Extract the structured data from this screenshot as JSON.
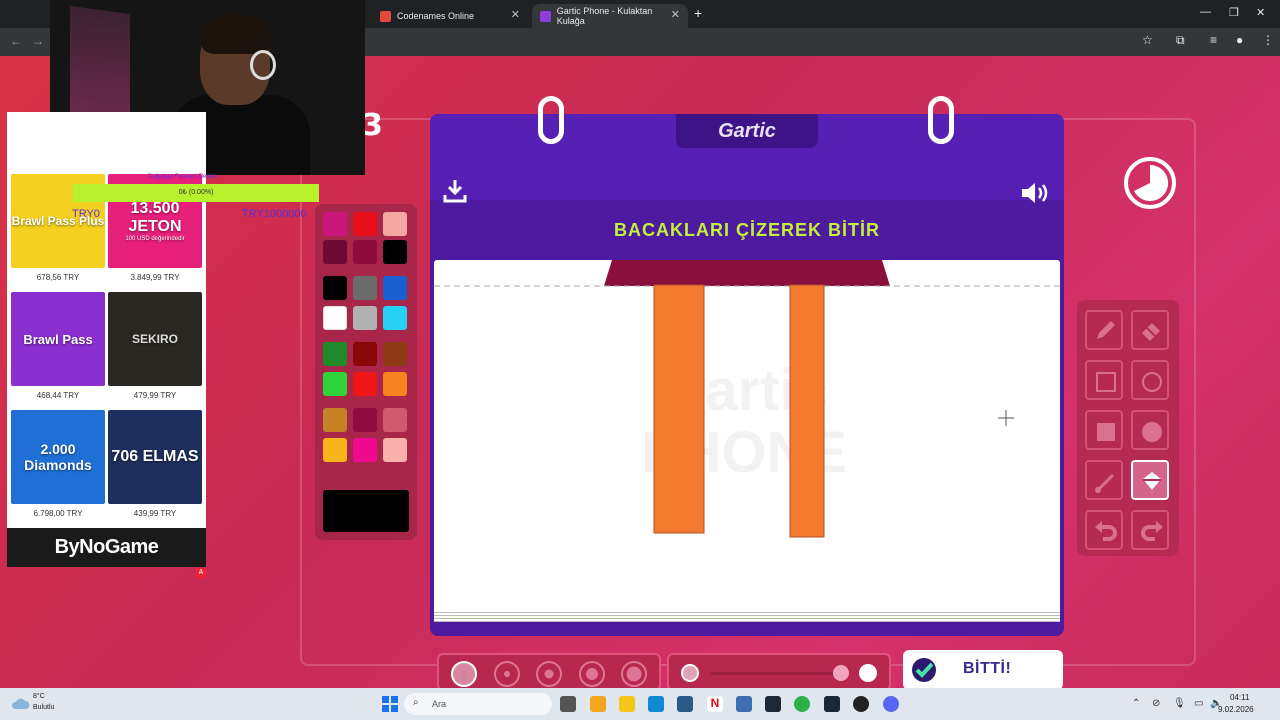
{
  "browser": {
    "tabs": [
      {
        "title": "Codenames Online"
      },
      {
        "title": "Gartic Phone - Kulaktan Kulağa"
      }
    ]
  },
  "game": {
    "round_number": "3",
    "logo": "Gartic",
    "prompt": "BACAKLARI ÇİZEREK BİTİR",
    "done_button": "BİTTİ!",
    "watermark_top": "Gartic",
    "watermark_bottom": "PHONE",
    "palette_colors": [
      "#c8157a",
      "#e80f1a",
      "#f7a7a2",
      "#6d0a33",
      "#8e0a3c",
      "#000000",
      "#000000",
      "#6b6b6b",
      "#1a5fd1",
      "#ffffff",
      "#b1b1b1",
      "#27d1f3",
      "#1e8a2a",
      "#8a0808",
      "#8e3a15",
      "#2fd33a",
      "#ef1515",
      "#f5831f",
      "#c58325",
      "#8f0a3e",
      "#d15a73",
      "#f6b31a",
      "#f0088e",
      "#f8b1ad"
    ],
    "current_color": "#000000",
    "tools": [
      "pencil-tool",
      "eraser-tool",
      "rectangle-outline-tool",
      "ellipse-outline-tool",
      "rectangle-fill-tool",
      "ellipse-fill-tool",
      "line-tool",
      "fill-bucket-tool",
      "undo-tool",
      "redo-tool"
    ],
    "active_tool": "fill-bucket-tool",
    "brush_sizes": [
      "1",
      "2",
      "3",
      "4",
      "5"
    ],
    "active_brush_size": "1",
    "opacity_level": 1.0,
    "drawing": {
      "hat_color": "#8a0f3d",
      "leg_color": "#f47a2e"
    }
  },
  "ads": {
    "items": [
      {
        "title": "Brawl Pass Plus",
        "price": "678,56 TRY",
        "bg": "#f4d020"
      },
      {
        "title": "13.500 JETON",
        "subtitle": "100 USD değerindedir",
        "price": "3.849,99 TRY",
        "bg": "#e7207c"
      },
      {
        "title": "Brawl Pass",
        "price": "468,44 TRY",
        "bg": "#8a2fd0"
      },
      {
        "title": "SEKIRO",
        "price": "479,99 TRY",
        "bg": "#2a2722"
      },
      {
        "title": "2.000 Diamonds",
        "price": "6.798,00 TRY",
        "bg": "#1f6fd6"
      },
      {
        "title": "706 ELMAS",
        "price": "439,99 TRY",
        "bg": "#1d2f5e"
      }
    ],
    "footer": "ByNoGame",
    "donation": {
      "title": "Doğalgaz Faturası Destek",
      "progress_text": "0₺ (0.00%)",
      "progress": 0.0,
      "min_label": "TRY0",
      "max_label": "TRY1000000"
    }
  },
  "taskbar": {
    "weather_temp": "8°C",
    "weather_desc": "Bulutlu",
    "search_placeholder": "Ara",
    "time": "04:11",
    "date": "9.02.2026"
  }
}
